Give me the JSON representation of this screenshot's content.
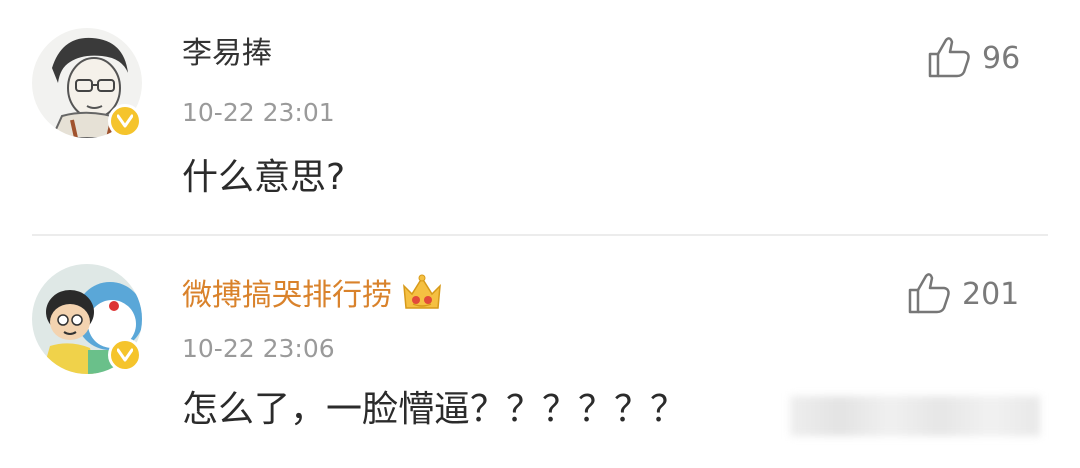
{
  "comments": [
    {
      "username": "李易捧",
      "timestamp": "10-22 23:01",
      "text": "什么意思?",
      "likes": "96",
      "verified": true,
      "username_color": "#333333"
    },
    {
      "username": "微搏搞哭排行捞",
      "timestamp": "10-22 23:06",
      "text": "怎么了，一脸懵逼？？？？？？",
      "likes": "201",
      "verified": true,
      "username_color": "#d9822b",
      "badge_icon": "crown-icon"
    }
  ],
  "colors": {
    "verified_badge": "#f5c42c",
    "timestamp": "#9a9a9a",
    "vip_username": "#d9822b"
  }
}
